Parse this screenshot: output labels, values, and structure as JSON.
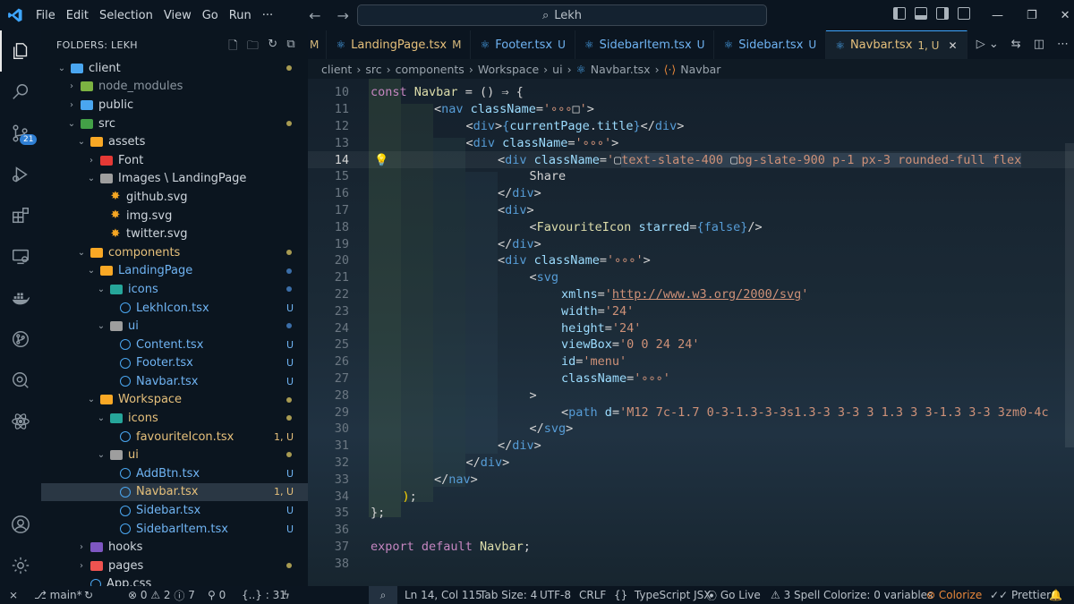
{
  "titlebar": {
    "menu": [
      "File",
      "Edit",
      "Selection",
      "View",
      "Go",
      "Run",
      "···"
    ],
    "search": "Lekh"
  },
  "activity": {
    "badge": "21"
  },
  "sidebar": {
    "header": "FOLDERS: LEKH",
    "tree": [
      {
        "label": "client",
        "level": 0,
        "type": "folder",
        "open": true,
        "color": "#4aa6f0",
        "status": "dot",
        "status_color": "#a89b52"
      },
      {
        "label": "node_modules",
        "level": 1,
        "type": "folder",
        "open": false,
        "color": "#7cb342",
        "status": "",
        "muted": true
      },
      {
        "label": "public",
        "level": 1,
        "type": "folder",
        "open": false,
        "color": "#4aa6f0",
        "status": ""
      },
      {
        "label": "src",
        "level": 1,
        "type": "folder",
        "open": true,
        "color": "#43a047",
        "status": "dot",
        "status_color": "#a89b52"
      },
      {
        "label": "assets",
        "level": 2,
        "type": "folder",
        "open": true,
        "color": "#f9a825",
        "status": ""
      },
      {
        "label": "Font",
        "level": 3,
        "type": "folder",
        "open": false,
        "color": "#e53935",
        "status": ""
      },
      {
        "label": "Images \\ LandingPage",
        "level": 3,
        "type": "folder",
        "open": true,
        "color": "#9e9e9e",
        "status": ""
      },
      {
        "label": "github.svg",
        "level": 4,
        "type": "svg",
        "status": ""
      },
      {
        "label": "img.svg",
        "level": 4,
        "type": "svg",
        "status": ""
      },
      {
        "label": "twitter.svg",
        "level": 4,
        "type": "svg",
        "status": ""
      },
      {
        "label": "components",
        "level": 2,
        "type": "folder",
        "open": true,
        "color": "#f9a825",
        "status": "dot",
        "status_color": "#a89b52",
        "tc": "#e6c07b"
      },
      {
        "label": "LandingPage",
        "level": 3,
        "type": "folder",
        "open": true,
        "color": "#f9a825",
        "status": "dot",
        "status_color": "#3b6ea8",
        "tc": "#6fb3f2"
      },
      {
        "label": "icons",
        "level": 4,
        "type": "folder",
        "open": true,
        "color": "#26a69a",
        "status": "dot",
        "status_color": "#3b6ea8",
        "tc": "#6fb3f2"
      },
      {
        "label": "LekhIcon.tsx",
        "level": 5,
        "type": "file",
        "status": "U",
        "tc": "#6fb3f2"
      },
      {
        "label": "ui",
        "level": 4,
        "type": "folder",
        "open": true,
        "color": "#9e9e9e",
        "status": "dot",
        "status_color": "#3b6ea8",
        "tc": "#6fb3f2"
      },
      {
        "label": "Content.tsx",
        "level": 5,
        "type": "file",
        "status": "U",
        "tc": "#6fb3f2"
      },
      {
        "label": "Footer.tsx",
        "level": 5,
        "type": "file",
        "status": "U",
        "tc": "#6fb3f2"
      },
      {
        "label": "Navbar.tsx",
        "level": 5,
        "type": "file",
        "status": "U",
        "tc": "#6fb3f2"
      },
      {
        "label": "Workspace",
        "level": 3,
        "type": "folder",
        "open": true,
        "color": "#f9a825",
        "status": "dot",
        "status_color": "#a89b52",
        "tc": "#e6c07b"
      },
      {
        "label": "icons",
        "level": 4,
        "type": "folder",
        "open": true,
        "color": "#26a69a",
        "status": "dot",
        "status_color": "#a89b52",
        "tc": "#e6c07b"
      },
      {
        "label": "favouriteIcon.tsx",
        "level": 5,
        "type": "file",
        "status": "1, U",
        "tc": "#e6c07b"
      },
      {
        "label": "ui",
        "level": 4,
        "type": "folder",
        "open": true,
        "color": "#9e9e9e",
        "status": "dot",
        "status_color": "#a89b52",
        "tc": "#e6c07b"
      },
      {
        "label": "AddBtn.tsx",
        "level": 5,
        "type": "file",
        "status": "U",
        "tc": "#6fb3f2"
      },
      {
        "label": "Navbar.tsx",
        "level": 5,
        "type": "file",
        "status": "1, U",
        "tc": "#e6c07b",
        "selected": true
      },
      {
        "label": "Sidebar.tsx",
        "level": 5,
        "type": "file",
        "status": "U",
        "tc": "#6fb3f2"
      },
      {
        "label": "SidebarItem.tsx",
        "level": 5,
        "type": "file",
        "status": "U",
        "tc": "#6fb3f2"
      },
      {
        "label": "hooks",
        "level": 2,
        "type": "folder",
        "open": false,
        "color": "#7e57c2",
        "status": ""
      },
      {
        "label": "pages",
        "level": 2,
        "type": "folder",
        "open": false,
        "color": "#ef5350",
        "status": "dot",
        "status_color": "#a89b52"
      },
      {
        "label": "App.css",
        "level": 2,
        "type": "file",
        "status": ""
      }
    ]
  },
  "tabs": [
    {
      "label": "M",
      "icon": "",
      "status": "",
      "partial": true
    },
    {
      "label": "LandingPage.tsx",
      "status": "M"
    },
    {
      "label": "Footer.tsx",
      "status": "U"
    },
    {
      "label": "SidebarItem.tsx",
      "status": "U"
    },
    {
      "label": "Sidebar.tsx",
      "status": "U"
    },
    {
      "label": "Navbar.tsx",
      "status": "1, U",
      "active": true
    }
  ],
  "breadcrumb": [
    "client",
    "src",
    "components",
    "Workspace",
    "ui",
    "Navbar.tsx",
    "Navbar"
  ],
  "editor": {
    "current_line": 14,
    "lines": [
      {
        "n": "10",
        "html": "<span class='kw'>const</span> <span class='fn'>Navbar</span> <span class='pl'>= () ⇒ {</span>",
        "indent": 0
      },
      {
        "n": "11",
        "html": "<span class='pl'>&lt;</span><span class='kw2'>nav</span> <span class='at'>className</span><span class='pl'>=</span><span class='str'>'∘∘∘</span><span class='pl'>□</span><span class='str'>'</span><span class='pl'>&gt;</span>",
        "indent": 2
      },
      {
        "n": "12",
        "html": "<span class='pl'>&lt;</span><span class='kw2'>div</span><span class='pl'>&gt;</span><span class='kw2'>{</span><span class='at'>currentPage</span><span class='pl'>.</span><span class='at'>title</span><span class='kw2'>}</span><span class='pl'>&lt;/</span><span class='kw2'>div</span><span class='pl'>&gt;</span>",
        "indent": 3
      },
      {
        "n": "13",
        "html": "<span class='pl'>&lt;</span><span class='kw2'>div</span> <span class='at'>className</span><span class='pl'>=</span><span class='str'>'∘∘∘'</span><span class='pl'>&gt;</span>",
        "indent": 3
      },
      {
        "n": "14",
        "html": "<span class='pl'>&lt;</span><span class='kw2'>div</span> <span class='at'>className</span><span class='pl'>=</span><span class='str'>'</span><span class='pl'>▢</span><span class='str sel'>text-slate-400 </span><span class='pl sel'>▢</span><span class='str sel'>bg-slate-900 p-1 px-3 rounded-full flex</span>",
        "indent": 4
      },
      {
        "n": "15",
        "html": "<span class='pl'>Share</span>",
        "indent": 5
      },
      {
        "n": "16",
        "html": "<span class='pl'>&lt;/</span><span class='kw2'>div</span><span class='pl'>&gt;</span>",
        "indent": 4
      },
      {
        "n": "17",
        "html": "<span class='pl'>&lt;</span><span class='kw2'>div</span><span class='pl'>&gt;</span>",
        "indent": 4
      },
      {
        "n": "18",
        "html": "<span class='pl'>&lt;</span><span class='fn'>FavouriteIcon</span> <span class='at'>starred</span><span class='pl'>=</span><span class='kw2'>{false}</span><span class='pl'>/&gt;</span>",
        "indent": 5
      },
      {
        "n": "19",
        "html": "<span class='pl'>&lt;/</span><span class='kw2'>div</span><span class='pl'>&gt;</span>",
        "indent": 4
      },
      {
        "n": "20",
        "html": "<span class='pl'>&lt;</span><span class='kw2'>div</span> <span class='at'>className</span><span class='pl'>=</span><span class='str'>'∘∘∘'</span><span class='pl'>&gt;</span>",
        "indent": 4
      },
      {
        "n": "21",
        "html": "<span class='pl'>&lt;</span><span class='kw2'>svg</span>",
        "indent": 5
      },
      {
        "n": "22",
        "html": "<span class='at'>xmlns</span><span class='pl'>=</span><span class='str'>'<span class='lnk'>http://www.w3.org/2000/svg</span>'</span>",
        "indent": 6
      },
      {
        "n": "23",
        "html": "<span class='at'>width</span><span class='pl'>=</span><span class='str'>'24'</span>",
        "indent": 6
      },
      {
        "n": "24",
        "html": "<span class='at'>height</span><span class='pl'>=</span><span class='str'>'24'</span>",
        "indent": 6
      },
      {
        "n": "25",
        "html": "<span class='at'>viewBox</span><span class='pl'>=</span><span class='str'>'0 0 24 24'</span>",
        "indent": 6
      },
      {
        "n": "26",
        "html": "<span class='at'>id</span><span class='pl'>=</span><span class='str'>'menu'</span>",
        "indent": 6
      },
      {
        "n": "27",
        "html": "<span class='at'>className</span><span class='pl'>=</span><span class='str'>'∘∘∘'</span>",
        "indent": 6
      },
      {
        "n": "28",
        "html": "<span class='pl'>&gt;</span>",
        "indent": 5
      },
      {
        "n": "29",
        "html": "<span class='pl'>&lt;</span><span class='kw2'>path</span> <span class='at'>d</span><span class='pl'>=</span><span class='str'>'M12 7c-1.7 0-3-1.3-3-3s1.3-3 3-3 3 1.3 3 3-1.3 3-3 3zm0-4c</span>",
        "indent": 6
      },
      {
        "n": "30",
        "html": "<span class='pl'>&lt;/</span><span class='kw2'>svg</span><span class='pl'>&gt;</span>",
        "indent": 5
      },
      {
        "n": "31",
        "html": "<span class='pl'>&lt;/</span><span class='kw2'>div</span><span class='pl'>&gt;</span>",
        "indent": 4
      },
      {
        "n": "32",
        "html": "<span class='pl'>&lt;/</span><span class='kw2'>div</span><span class='pl'>&gt;</span>",
        "indent": 3
      },
      {
        "n": "33",
        "html": "<span class='pl'>&lt;/</span><span class='kw2'>nav</span><span class='pl'>&gt;</span>",
        "indent": 2
      },
      {
        "n": "34",
        "html": "<span class='br'>)</span><span class='pl'>;</span>",
        "indent": 1
      },
      {
        "n": "35",
        "html": "<span class='pl'>};</span>",
        "indent": 0
      },
      {
        "n": "36",
        "html": "",
        "indent": 0
      },
      {
        "n": "37",
        "html": "<span class='kw'>export</span> <span class='kw'>default</span> <span class='fn'>Navbar</span><span class='pl'>;</span>",
        "indent": 0
      },
      {
        "n": "38",
        "html": "",
        "indent": 0
      }
    ]
  },
  "statusbar": {
    "branch": "main*",
    "errors": "0",
    "warnings": "2",
    "info": "7",
    "ports": "0",
    "braces": "{..} : 31",
    "position": "Ln 14, Col 115",
    "tabsize": "Tab Size: 4",
    "encoding": "UTF-8",
    "eol": "CRLF",
    "language": "TypeScript JSX",
    "golive": "Go Live",
    "spell": "3 Spell",
    "colorize_vars": "Colorize: 0 variables",
    "colorize": "Colorize",
    "prettier": "Prettier"
  },
  "colors": {
    "accent": "#3ea6ff",
    "modified": "#d7ba7d",
    "untracked": "#6fb3f2"
  }
}
